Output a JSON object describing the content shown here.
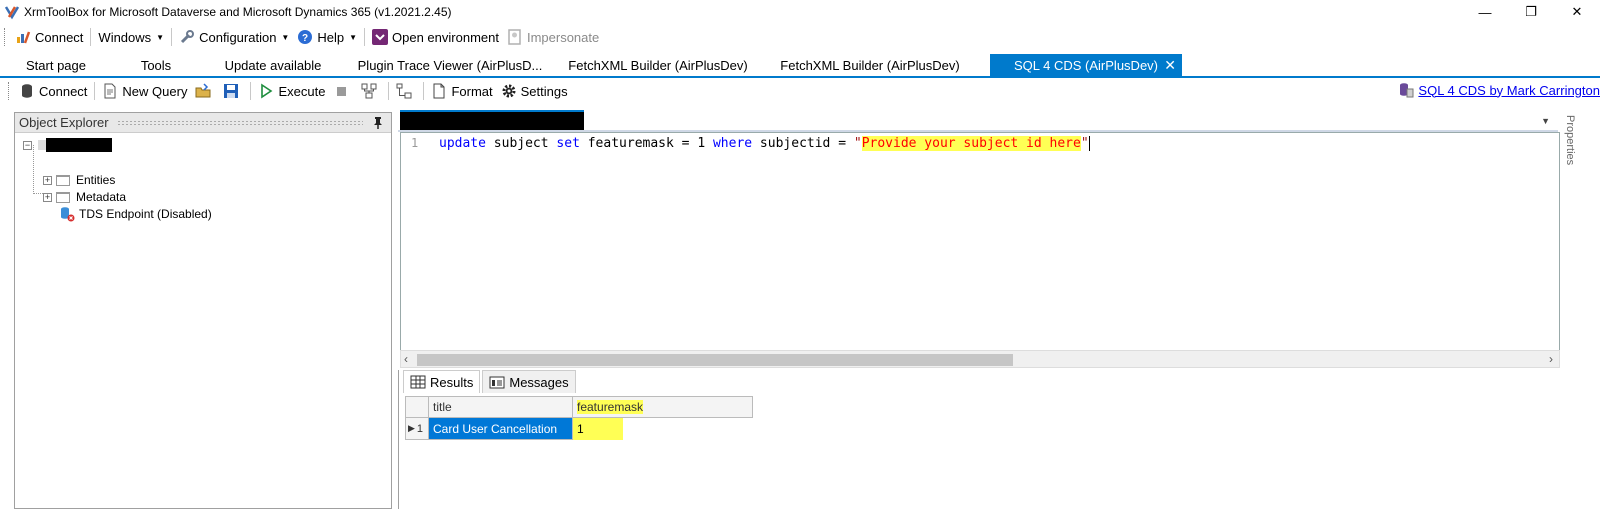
{
  "window": {
    "title": "XrmToolBox for Microsoft Dataverse and Microsoft Dynamics 365 (v1.2021.2.45)",
    "minimize": "—",
    "restore": "❐",
    "close": "✕"
  },
  "main_toolbar": {
    "connect": "Connect",
    "windows": "Windows",
    "configuration": "Configuration",
    "help": "Help",
    "open_environment": "Open environment",
    "impersonate": "Impersonate"
  },
  "tabs": [
    {
      "label": "Start page"
    },
    {
      "label": "Tools"
    },
    {
      "label": "Update available"
    },
    {
      "label": "Plugin Trace Viewer (AirPlusD..."
    },
    {
      "label": "FetchXML Builder (AirPlusDev)"
    },
    {
      "label": "FetchXML Builder (AirPlusDev)"
    },
    {
      "label": "SQL 4 CDS (AirPlusDev)",
      "active": true
    }
  ],
  "tab_close": "✕",
  "plugin_toolbar": {
    "connect": "Connect",
    "new_query": "New Query",
    "execute": "Execute",
    "format": "Format",
    "settings": "Settings",
    "author_link": "SQL 4 CDS by Mark Carrington"
  },
  "object_explorer": {
    "title": "Object Explorer",
    "items": [
      {
        "label": "Entities"
      },
      {
        "label": "Metadata"
      },
      {
        "label": "TDS Endpoint (Disabled)"
      }
    ]
  },
  "editor": {
    "line_number": "1",
    "code": {
      "kw_update": "update",
      "t1": " subject ",
      "kw_set": "set",
      "t2": " featuremask = ",
      "num": "1",
      "t3": " ",
      "kw_where": "where",
      "t4": " subjectid = ",
      "quote_open": "\"",
      "string_value": "Provide your subject id here",
      "quote_close": "\""
    },
    "properties_label": "Properties"
  },
  "results": {
    "tabs": {
      "results": "Results",
      "messages": "Messages"
    },
    "columns": [
      "title",
      "featuremask"
    ],
    "rows": [
      {
        "indicator": "▶",
        "index": "1",
        "title": "Card User Cancellation",
        "featuremask": "1"
      }
    ]
  },
  "colors": {
    "accent": "#007acc",
    "selection": "#0078d7",
    "highlight": "#ffff55",
    "keyword": "#0000ff",
    "string": "#a31515"
  }
}
